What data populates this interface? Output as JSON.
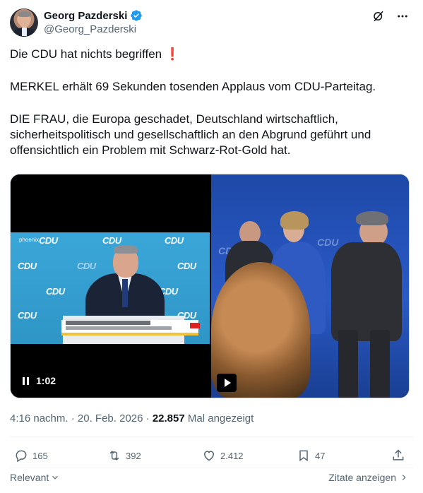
{
  "author": {
    "display_name": "Georg Pazderski",
    "handle": "@Georg_Pazderski",
    "verified": true
  },
  "tweet": {
    "line1": "Die CDU hat nichts begriffen",
    "line1_emoji": "❗",
    "line2": "MERKEL erhält 69 Sekunden tosenden Applaus vom CDU-Parteitag.",
    "line3": "DIE FRAU, die Europa geschadet, Deutschland wirtschaftlich, sicherheitspolitisch und gesellschaftlich an den Abgrund geführt und offensichtlich ein Problem mit Schwarz-Rot-Gold hat."
  },
  "media": {
    "left_video": {
      "duration": "1:02",
      "state": "playing",
      "banner_text": "CDU",
      "channel_label": "phoenix"
    },
    "right_video": {
      "state": "paused"
    }
  },
  "meta": {
    "time": "4:16 nachm.",
    "date": "20. Feb. 2026",
    "views": "22.857",
    "views_label": "Mal angezeigt",
    "separator": "·"
  },
  "actions": {
    "replies": "165",
    "reposts": "392",
    "likes": "2.412",
    "bookmarks": "47"
  },
  "footer": {
    "sort_label": "Relevant",
    "quotes_label": "Zitate anzeigen"
  },
  "icons": {
    "verified": "verified-badge-icon",
    "grok": "grok-icon",
    "more": "more-icon",
    "reply": "reply-icon",
    "repost": "repost-icon",
    "like": "heart-icon",
    "bookmark": "bookmark-icon",
    "share": "share-icon"
  },
  "colors": {
    "accent": "#1d9bf0",
    "text": "#0f1419",
    "secondary": "#536471",
    "exclamation": "#d8232a"
  }
}
